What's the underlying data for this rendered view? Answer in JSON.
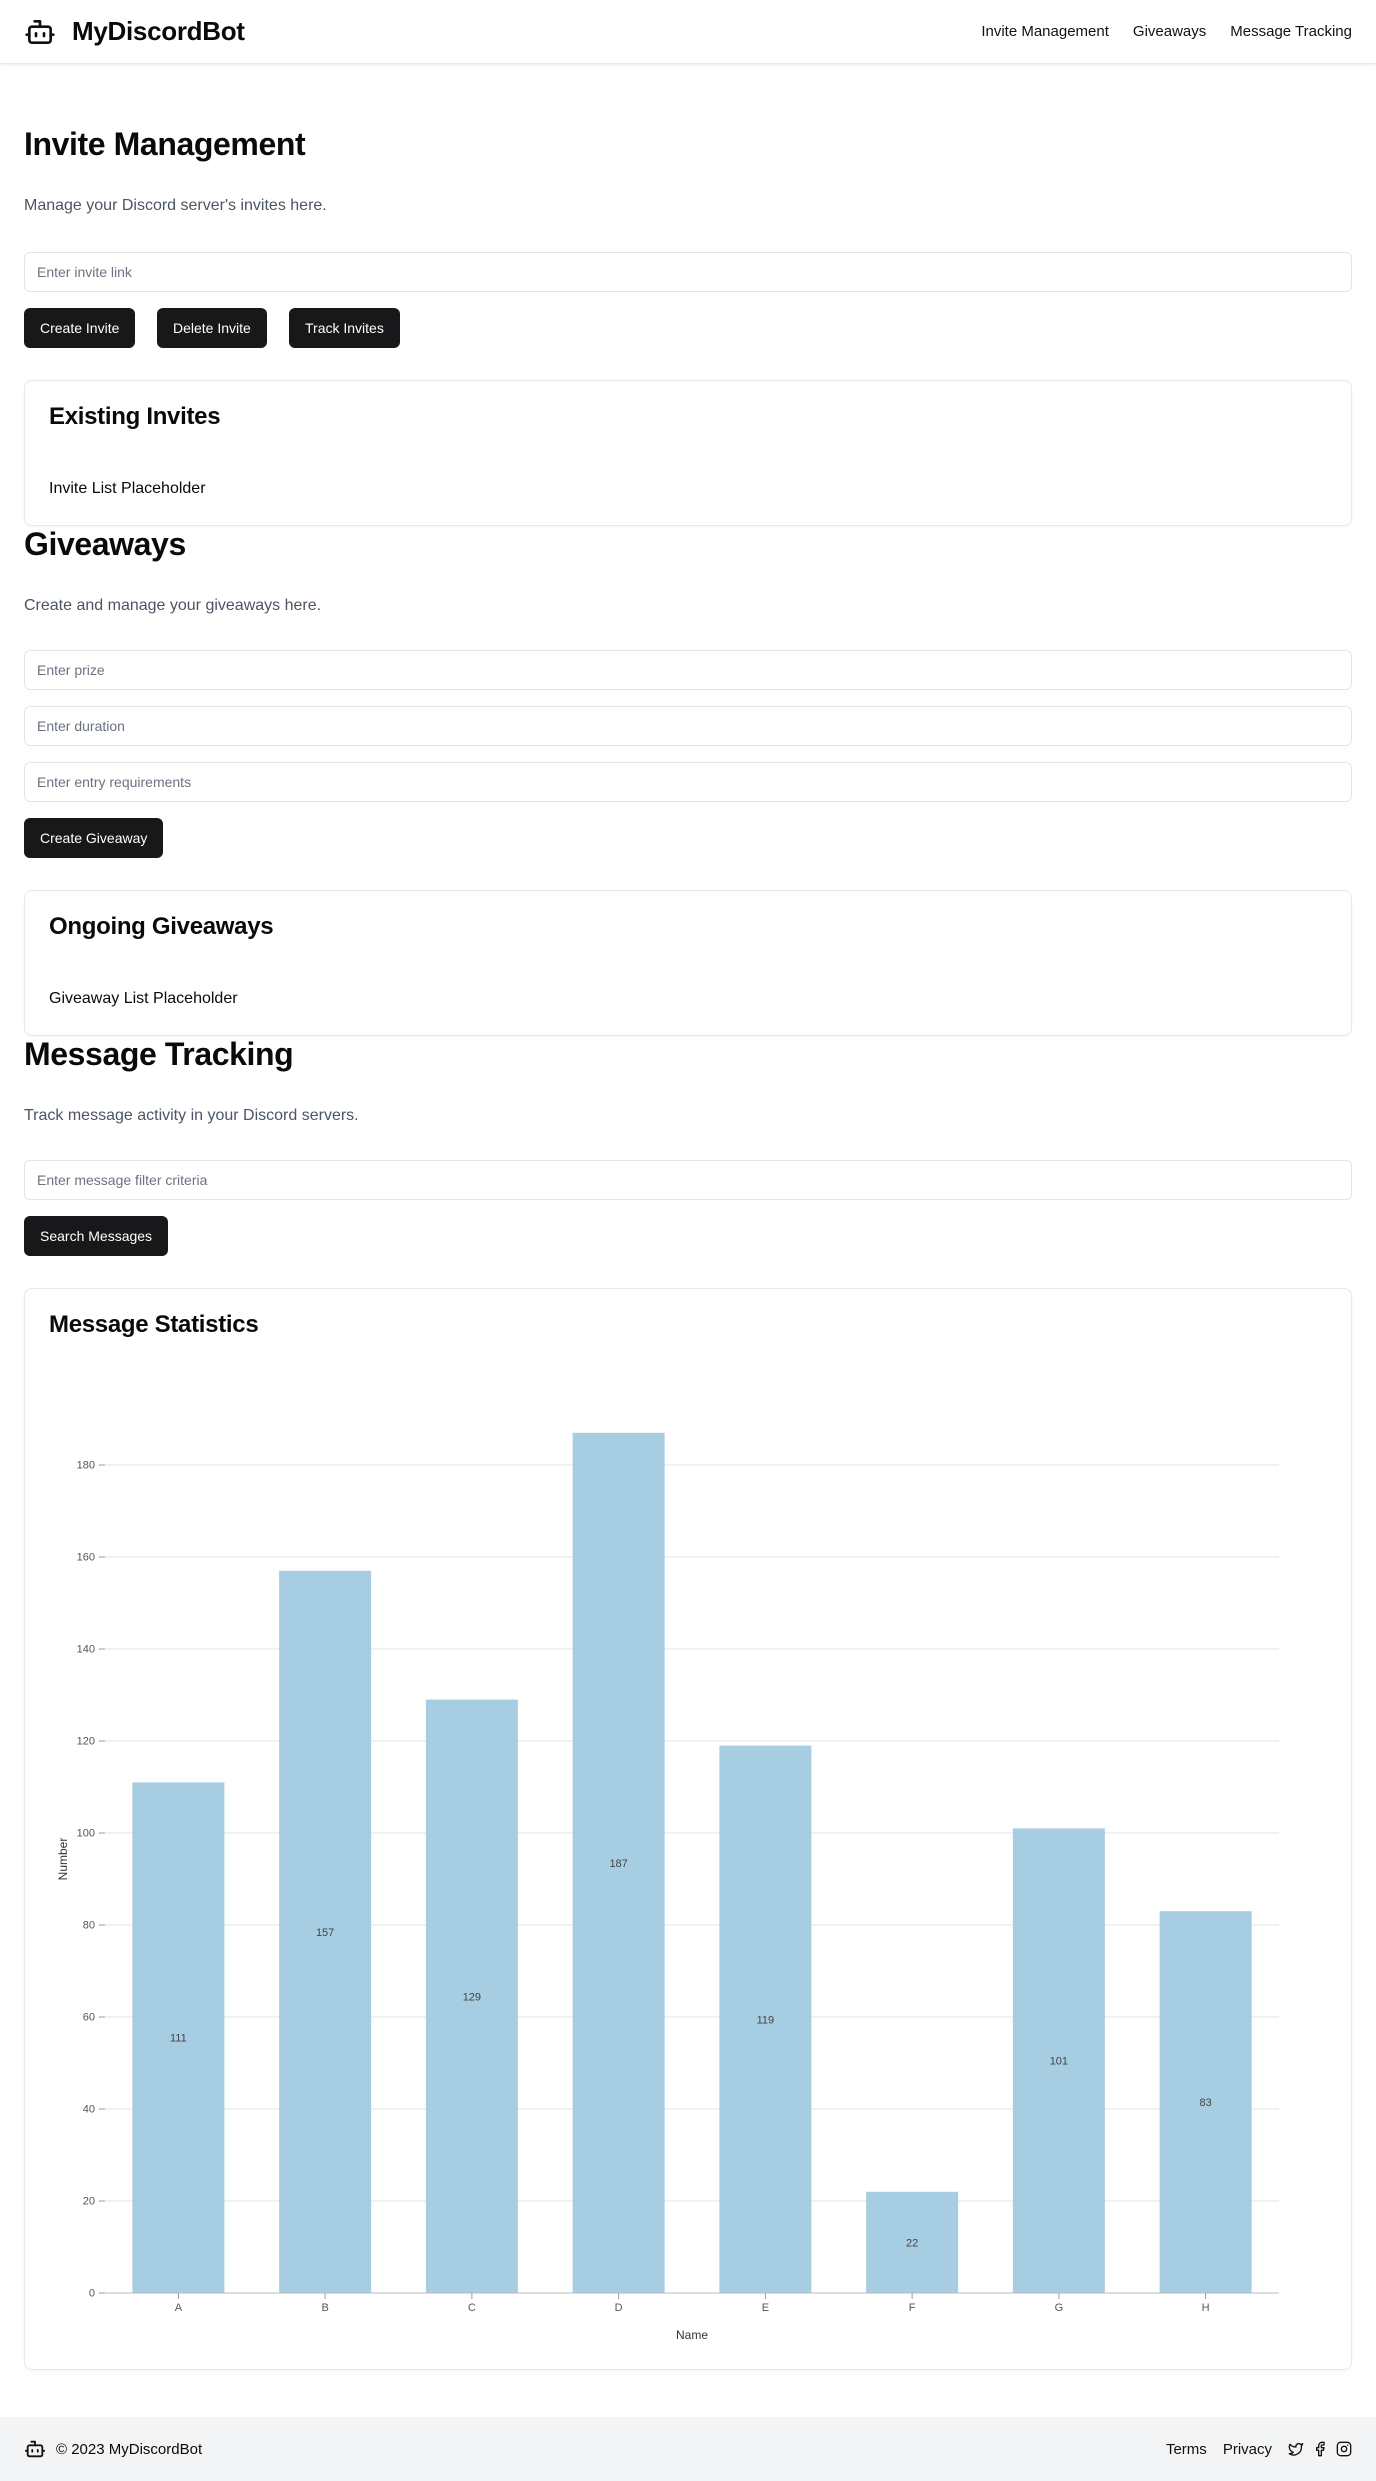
{
  "header": {
    "brand": "MyDiscordBot",
    "nav": [
      "Invite Management",
      "Giveaways",
      "Message Tracking"
    ]
  },
  "invite": {
    "title": "Invite Management",
    "description": "Manage your Discord server's invites here.",
    "input_placeholder": "Enter invite link",
    "buttons": [
      "Create Invite",
      "Delete Invite",
      "Track Invites"
    ],
    "card_title": "Existing Invites",
    "card_body": "Invite List Placeholder"
  },
  "giveaways": {
    "title": "Giveaways",
    "description": "Create and manage your giveaways here.",
    "prize_placeholder": "Enter prize",
    "duration_placeholder": "Enter duration",
    "requirements_placeholder": "Enter entry requirements",
    "button": "Create Giveaway",
    "card_title": "Ongoing Giveaways",
    "card_body": "Giveaway List Placeholder"
  },
  "messages": {
    "title": "Message Tracking",
    "description": "Track message activity in your Discord servers.",
    "filter_placeholder": "Enter message filter criteria",
    "button": "Search Messages",
    "card_title": "Message Statistics"
  },
  "chart_data": {
    "type": "bar",
    "categories": [
      "A",
      "B",
      "C",
      "D",
      "E",
      "F",
      "G",
      "H"
    ],
    "values": [
      111,
      157,
      129,
      187,
      119,
      22,
      101,
      83
    ],
    "xlabel": "Name",
    "ylabel": "Number",
    "ylim": [
      0,
      180
    ],
    "yticks": [
      0,
      20,
      40,
      60,
      80,
      100,
      120,
      140,
      160,
      180
    ],
    "grid": true,
    "bar_color": "#a6cde1",
    "data_labels": true
  },
  "footer": {
    "copyright": "© 2023 MyDiscordBot",
    "links": [
      "Terms",
      "Privacy"
    ],
    "social_icons": [
      "twitter-icon",
      "facebook-icon",
      "instagram-icon"
    ]
  }
}
